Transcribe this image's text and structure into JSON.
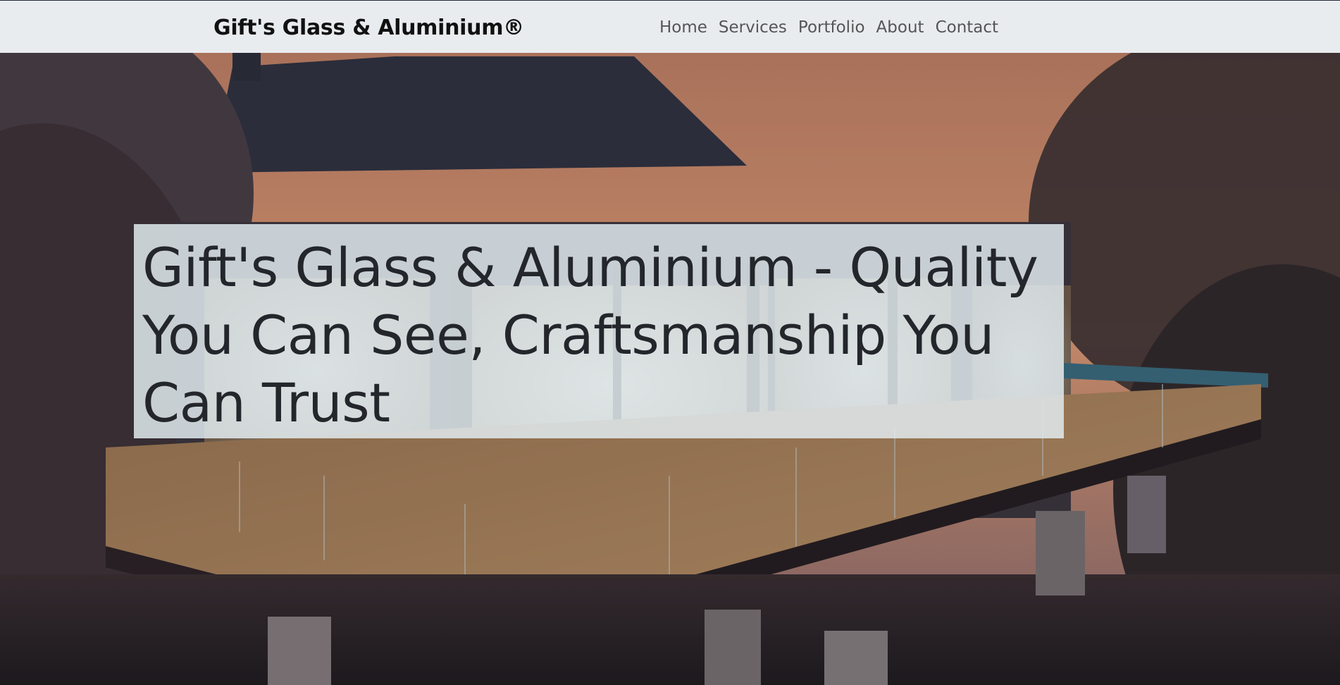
{
  "navbar": {
    "brand": "Gift's Glass & Aluminium®",
    "links": [
      "Home",
      "Services",
      "Portfolio",
      "About",
      "Contact"
    ]
  },
  "hero": {
    "headline": "Gift's Glass & Aluminium - Quality You Can See, Craftsmanship You Can Trust",
    "image_description_icon": "house-deck-photo"
  },
  "colors": {
    "navbar_bg": "#e9ecef",
    "headline_box_bg": "#e1eaee",
    "headline_text": "#23262b"
  }
}
